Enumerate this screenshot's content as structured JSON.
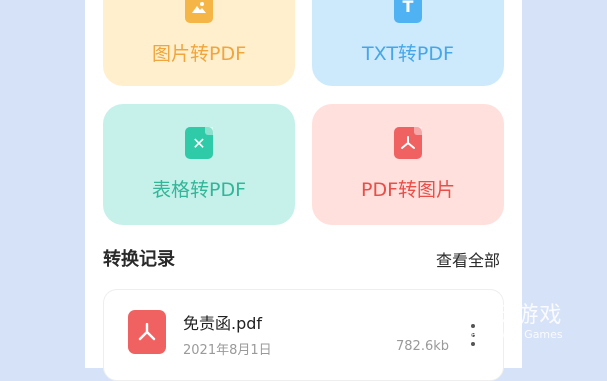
{
  "colors": {
    "background": "#d6e2f8",
    "panel": "#ffffff",
    "image_card_bg": "#ffefcd",
    "txt_card_bg": "#cdeafc",
    "excel_card_bg": "#c6f1ea",
    "pdf_card_bg": "#ffe0dc"
  },
  "tools": {
    "image_to_pdf": {
      "label": "图片转PDF",
      "icon": "image-file-icon"
    },
    "txt_to_pdf": {
      "label": "TXT转PDF",
      "icon": "text-file-icon"
    },
    "excel_to_pdf": {
      "label": "表格转PDF",
      "icon": "excel-file-icon"
    },
    "pdf_to_image": {
      "label": "PDF转图片",
      "icon": "pdf-file-icon"
    }
  },
  "history": {
    "title": "转换记录",
    "view_all": "查看全部",
    "items": [
      {
        "name": "免责函.pdf",
        "date": "2021年8月1日",
        "size": "782.6kb",
        "icon": "pdf-file-icon"
      }
    ]
  },
  "watermark": {
    "cn": "仍玩游戏",
    "en": "Renowan Games"
  }
}
